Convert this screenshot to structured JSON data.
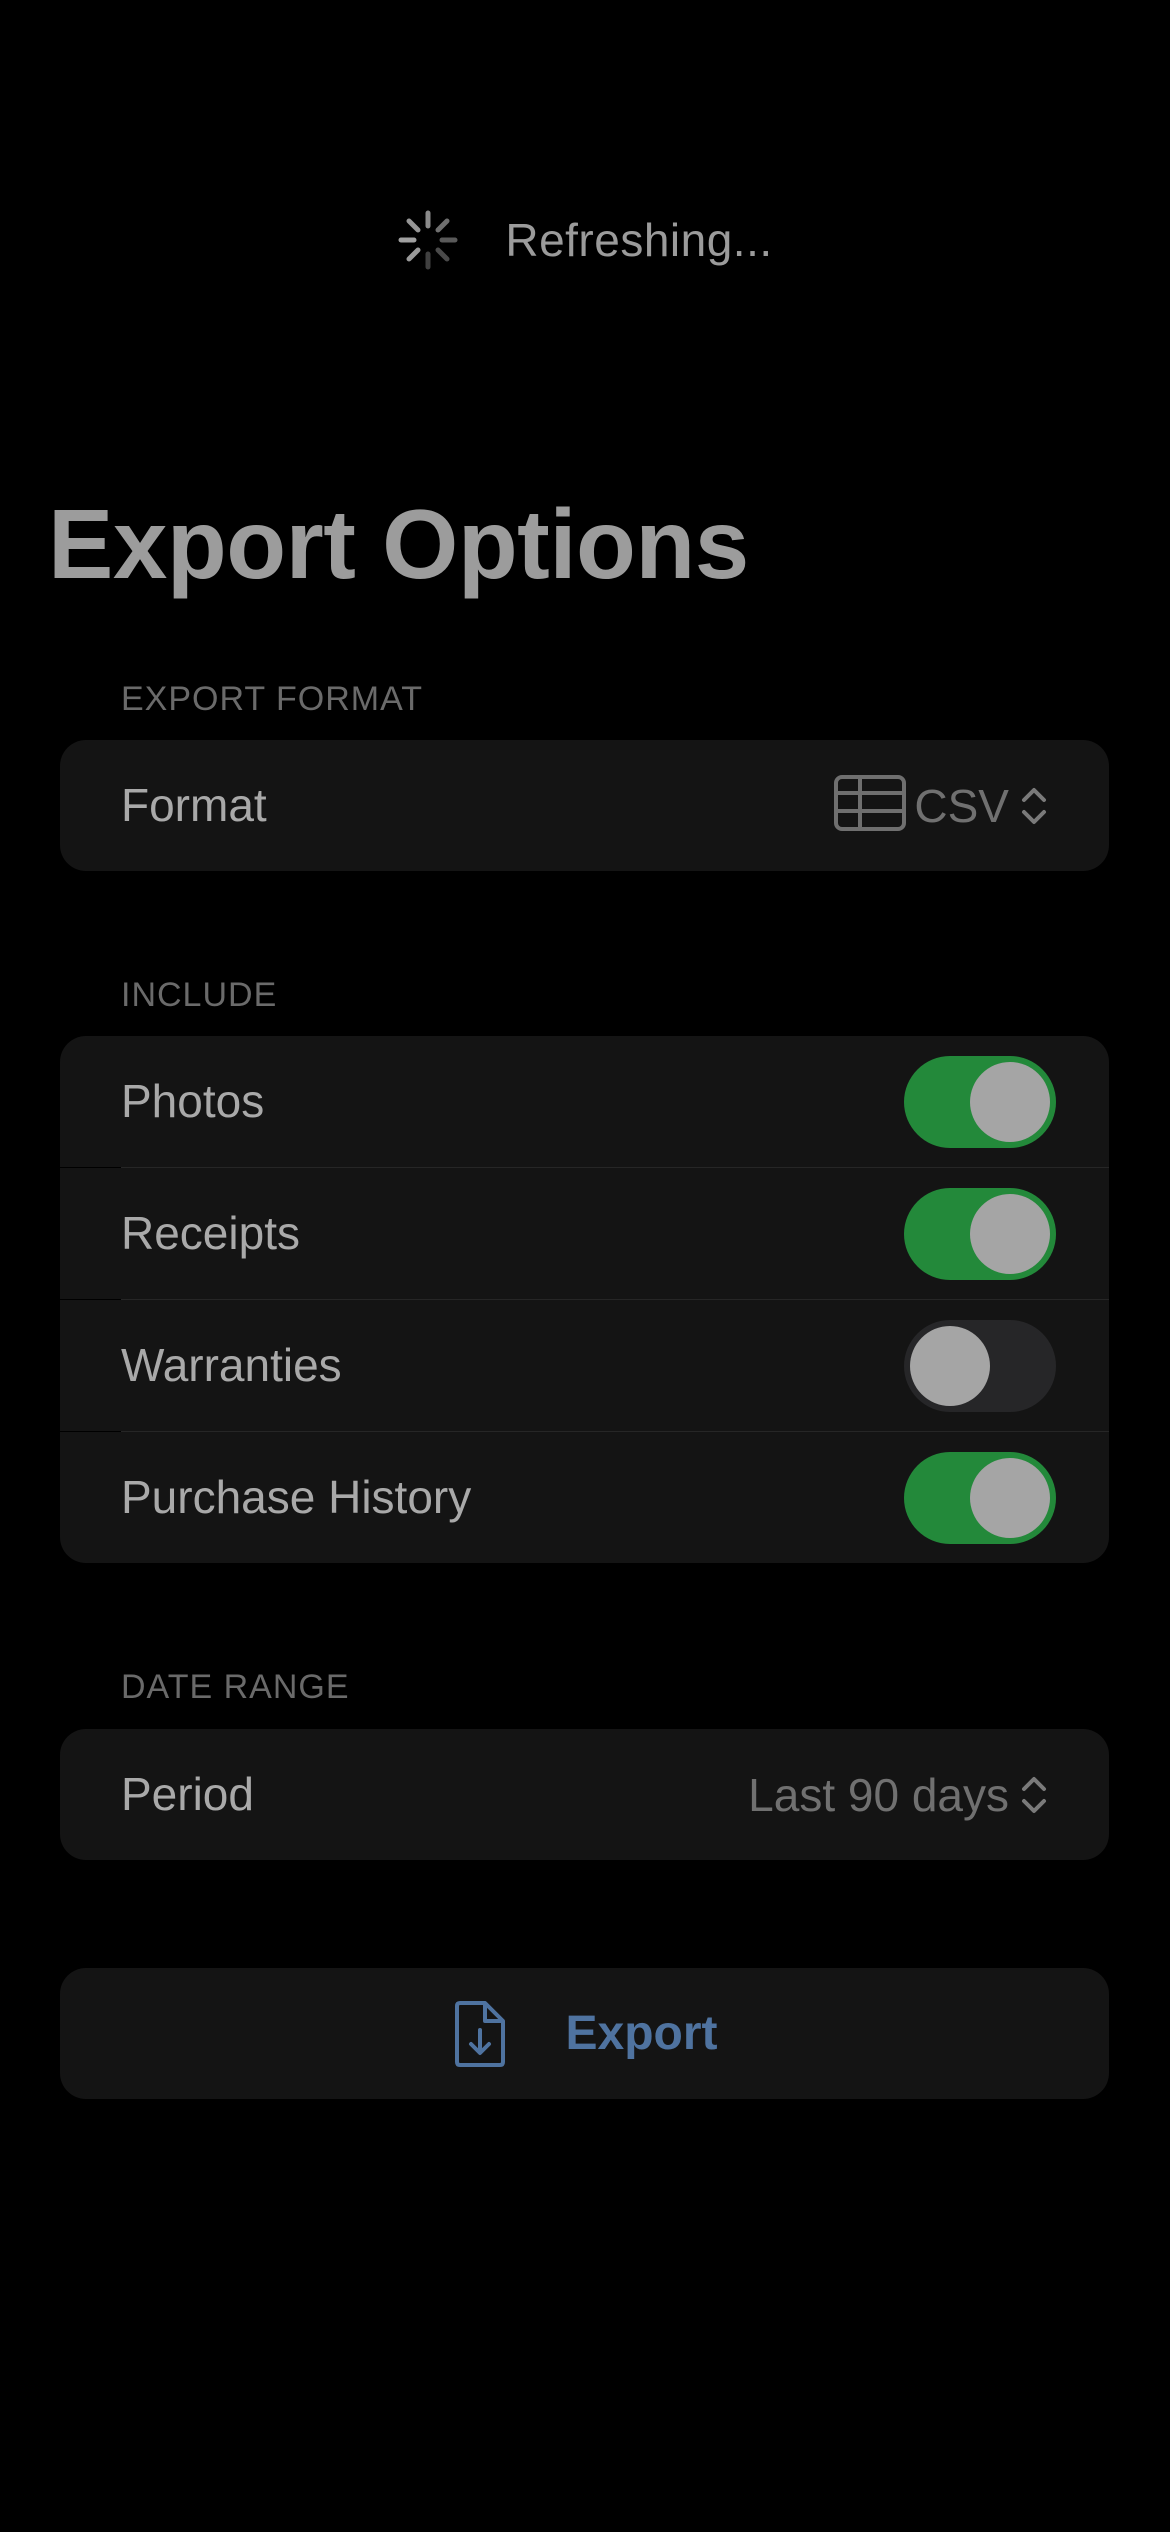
{
  "status": {
    "refresh_label": "Refreshing...",
    "spinner_icon": "activity-spinner-icon"
  },
  "header": {
    "title": "Export Options"
  },
  "sections": {
    "format": {
      "header": "EXPORT FORMAT",
      "row_label": "Format",
      "value": "CSV",
      "value_icon": "table-icon",
      "chevron_icon": "chevron-up-down-icon"
    },
    "include": {
      "header": "INCLUDE",
      "items": [
        {
          "label": "Photos",
          "enabled": true
        },
        {
          "label": "Receipts",
          "enabled": true
        },
        {
          "label": "Warranties",
          "enabled": false
        },
        {
          "label": "Purchase History",
          "enabled": true
        }
      ]
    },
    "date_range": {
      "header": "DATE RANGE",
      "row_label": "Period",
      "value": "Last 90 days",
      "chevron_icon": "chevron-up-down-icon"
    }
  },
  "actions": {
    "export_label": "Export",
    "export_icon": "document-download-icon"
  },
  "colors": {
    "background": "#000000",
    "card": "#141414",
    "toggle_on": "#23893a",
    "toggle_off": "#262628",
    "accent": "#4f73a0"
  }
}
